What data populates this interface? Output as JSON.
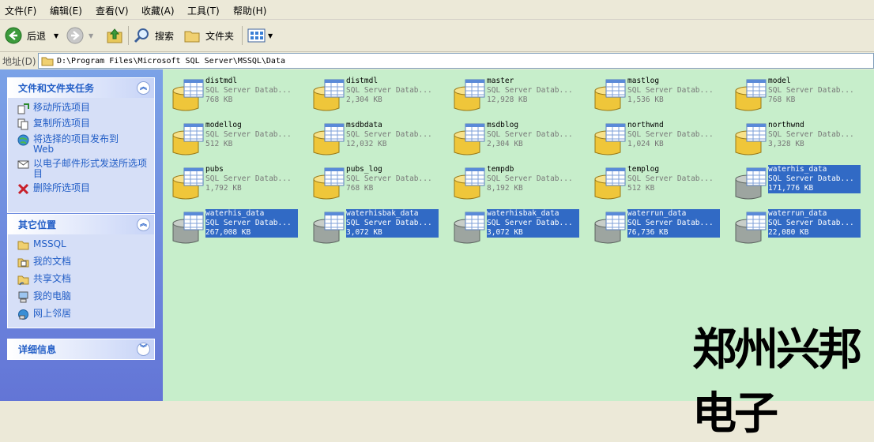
{
  "menu": [
    "文件(F)",
    "编辑(E)",
    "查看(V)",
    "收藏(A)",
    "工具(T)",
    "帮助(H)"
  ],
  "toolbar": {
    "back_label": "后退",
    "search_label": "搜索",
    "folders_label": "文件夹"
  },
  "address": {
    "label": "地址(D)",
    "path": "D:\\Program Files\\Microsoft SQL Server\\MSSQL\\Data"
  },
  "file_tasks": {
    "title": "文件和文件夹任务",
    "items": [
      {
        "label": "移动所选项目",
        "icon": "move-icon"
      },
      {
        "label": "复制所选项目",
        "icon": "copy-icon"
      },
      {
        "label": "将选择的项目发布到\nWeb",
        "icon": "publish-web-icon"
      },
      {
        "label": "以电子邮件形式发送所选项目",
        "icon": "email-icon"
      },
      {
        "label": "删除所选项目",
        "icon": "delete-icon"
      }
    ]
  },
  "other_places": {
    "title": "其它位置",
    "items": [
      {
        "label": "MSSQL",
        "icon": "folder-icon"
      },
      {
        "label": "我的文档",
        "icon": "my-documents-icon"
      },
      {
        "label": "共享文档",
        "icon": "shared-folder-icon"
      },
      {
        "label": "我的电脑",
        "icon": "my-computer-icon"
      },
      {
        "label": "网上邻居",
        "icon": "network-icon"
      }
    ]
  },
  "details": {
    "title": "详细信息"
  },
  "files": [
    {
      "name": "distmdl",
      "type": "SQL Server Datab...",
      "size": "768 KB",
      "selected": false,
      "icon": "sql-database-icon"
    },
    {
      "name": "distmdl",
      "type": "SQL Server Datab...",
      "size": "2,304 KB",
      "selected": false,
      "icon": "sql-database-icon"
    },
    {
      "name": "master",
      "type": "SQL Server Datab...",
      "size": "12,928 KB",
      "selected": false,
      "icon": "sql-database-icon"
    },
    {
      "name": "mastlog",
      "type": "SQL Server Datab...",
      "size": "1,536 KB",
      "selected": false,
      "icon": "sql-database-icon"
    },
    {
      "name": "model",
      "type": "SQL Server Datab...",
      "size": "768 KB",
      "selected": false,
      "icon": "sql-database-icon"
    },
    {
      "name": "modellog",
      "type": "SQL Server Datab...",
      "size": "512 KB",
      "selected": false,
      "icon": "sql-database-icon"
    },
    {
      "name": "msdbdata",
      "type": "SQL Server Datab...",
      "size": "12,032 KB",
      "selected": false,
      "icon": "sql-database-icon"
    },
    {
      "name": "msdblog",
      "type": "SQL Server Datab...",
      "size": "2,304 KB",
      "selected": false,
      "icon": "sql-database-icon"
    },
    {
      "name": "northwnd",
      "type": "SQL Server Datab...",
      "size": "1,024 KB",
      "selected": false,
      "icon": "sql-database-icon"
    },
    {
      "name": "northwnd",
      "type": "SQL Server Datab...",
      "size": "3,328 KB",
      "selected": false,
      "icon": "sql-database-icon"
    },
    {
      "name": "pubs",
      "type": "SQL Server Datab...",
      "size": "1,792 KB",
      "selected": false,
      "icon": "sql-database-icon"
    },
    {
      "name": "pubs_log",
      "type": "SQL Server Datab...",
      "size": "768 KB",
      "selected": false,
      "icon": "sql-database-icon"
    },
    {
      "name": "tempdb",
      "type": "SQL Server Datab...",
      "size": "8,192 KB",
      "selected": false,
      "icon": "sql-database-icon"
    },
    {
      "name": "templog",
      "type": "SQL Server Datab...",
      "size": "512 KB",
      "selected": false,
      "icon": "sql-database-icon"
    },
    {
      "name": "waterhis_data",
      "type": "SQL Server Datab...",
      "size": "171,776 KB",
      "selected": true,
      "icon": "sql-database-icon"
    },
    {
      "name": "waterhis_data",
      "type": "SQL Server Datab...",
      "size": "267,008 KB",
      "selected": true,
      "icon": "sql-database-icon"
    },
    {
      "name": "waterhisbak_data",
      "type": "SQL Server Datab...",
      "size": "3,072 KB",
      "selected": true,
      "icon": "sql-database-icon"
    },
    {
      "name": "waterhisbak_data",
      "type": "SQL Server Datab...",
      "size": "3,072 KB",
      "selected": true,
      "icon": "sql-database-icon"
    },
    {
      "name": "waterrun_data",
      "type": "SQL Server Datab...",
      "size": "76,736 KB",
      "selected": true,
      "icon": "sql-database-icon"
    },
    {
      "name": "waterrun_data",
      "type": "SQL Server Datab...",
      "size": "22,080 KB",
      "selected": true,
      "icon": "sql-database-icon"
    }
  ],
  "watermark": "郑州兴邦电子",
  "colors": {
    "content_bg": "#c7eecb",
    "selection": "#316ac5",
    "task_link": "#215dc6"
  }
}
